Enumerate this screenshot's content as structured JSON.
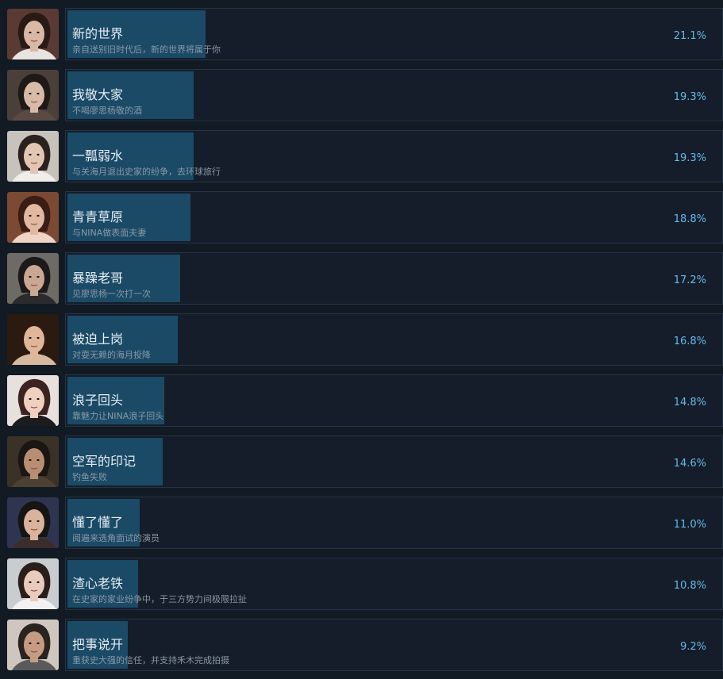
{
  "achievements": [
    {
      "title": "新的世界",
      "desc": "亲自送别旧时代后，新的世界将属于你",
      "percent_label": "21.1%",
      "percent": 21.1,
      "bg": "#5a3b33",
      "skin": "#d9b8a5",
      "hair": "#2a1a16",
      "shirt": "#e8e4e0"
    },
    {
      "title": "我敬大家",
      "desc": "不喝廖思杨敬的酒",
      "percent_label": "19.3%",
      "percent": 19.3,
      "bg": "#4b3f3a",
      "skin": "#d8bba6",
      "hair": "#1e1a18",
      "shirt": "#5b4a44"
    },
    {
      "title": "一瓢弱水",
      "desc": "与关海月退出史家的纷争，去环球旅行",
      "percent_label": "19.3%",
      "percent": 19.3,
      "bg": "#c8c2bd",
      "skin": "#e2c6b3",
      "hair": "#2b2220",
      "shirt": "#f1ede9"
    },
    {
      "title": "青青草原",
      "desc": "与NINA做表面夫妻",
      "percent_label": "18.8%",
      "percent": 18.8,
      "bg": "#7a4a32",
      "skin": "#e0b9a0",
      "hair": "#3a1d14",
      "shirt": "#f0d5c6"
    },
    {
      "title": "暴躁老哥",
      "desc": "见廖思杨一次打一次",
      "percent_label": "17.2%",
      "percent": 17.2,
      "bg": "#6e6a66",
      "skin": "#c9a793",
      "hair": "#1c1a19",
      "shirt": "#2b2b2d"
    },
    {
      "title": "被迫上岗",
      "desc": "对耍无赖的海月投降",
      "percent_label": "16.8%",
      "percent": 16.8,
      "bg": "#2a1a10",
      "skin": "#e0b69a",
      "hair": "#2c1a12",
      "shirt": "#d7b9a0"
    },
    {
      "title": "浪子回头",
      "desc": "靠魅力让NINA浪子回头",
      "percent_label": "14.8%",
      "percent": 14.8,
      "bg": "#e7e0dd",
      "skin": "#efcfbf",
      "hair": "#3b2420",
      "shirt": "#1c1c1e"
    },
    {
      "title": "空军的印记",
      "desc": "钓鱼失败",
      "percent_label": "14.6%",
      "percent": 14.6,
      "bg": "#3a3226",
      "skin": "#b88e72",
      "hair": "#1a1614",
      "shirt": "#4b4133"
    },
    {
      "title": "懂了懂了",
      "desc": "阅遍来选角面试的演员",
      "percent_label": "11.0%",
      "percent": 11.0,
      "bg": "#2f3550",
      "skin": "#d9b39b",
      "hair": "#171414",
      "shirt": "#3b2e2a"
    },
    {
      "title": "渣心老铁",
      "desc": "在史家的家业纷争中，于三方势力间极限拉扯",
      "percent_label": "10.8%",
      "percent": 10.8,
      "bg": "#c9cdd0",
      "skin": "#e8cbbb",
      "hair": "#2a1e1a",
      "shirt": "#f2f2f2"
    },
    {
      "title": "把事说开",
      "desc": "重获史大强的信任，并支持禾木完成拍摄",
      "percent_label": "9.2%",
      "percent": 9.2,
      "bg": "#cfc7bf",
      "skin": "#c59c82",
      "hair": "#2a2420",
      "shirt": "#5a5a5c"
    }
  ]
}
